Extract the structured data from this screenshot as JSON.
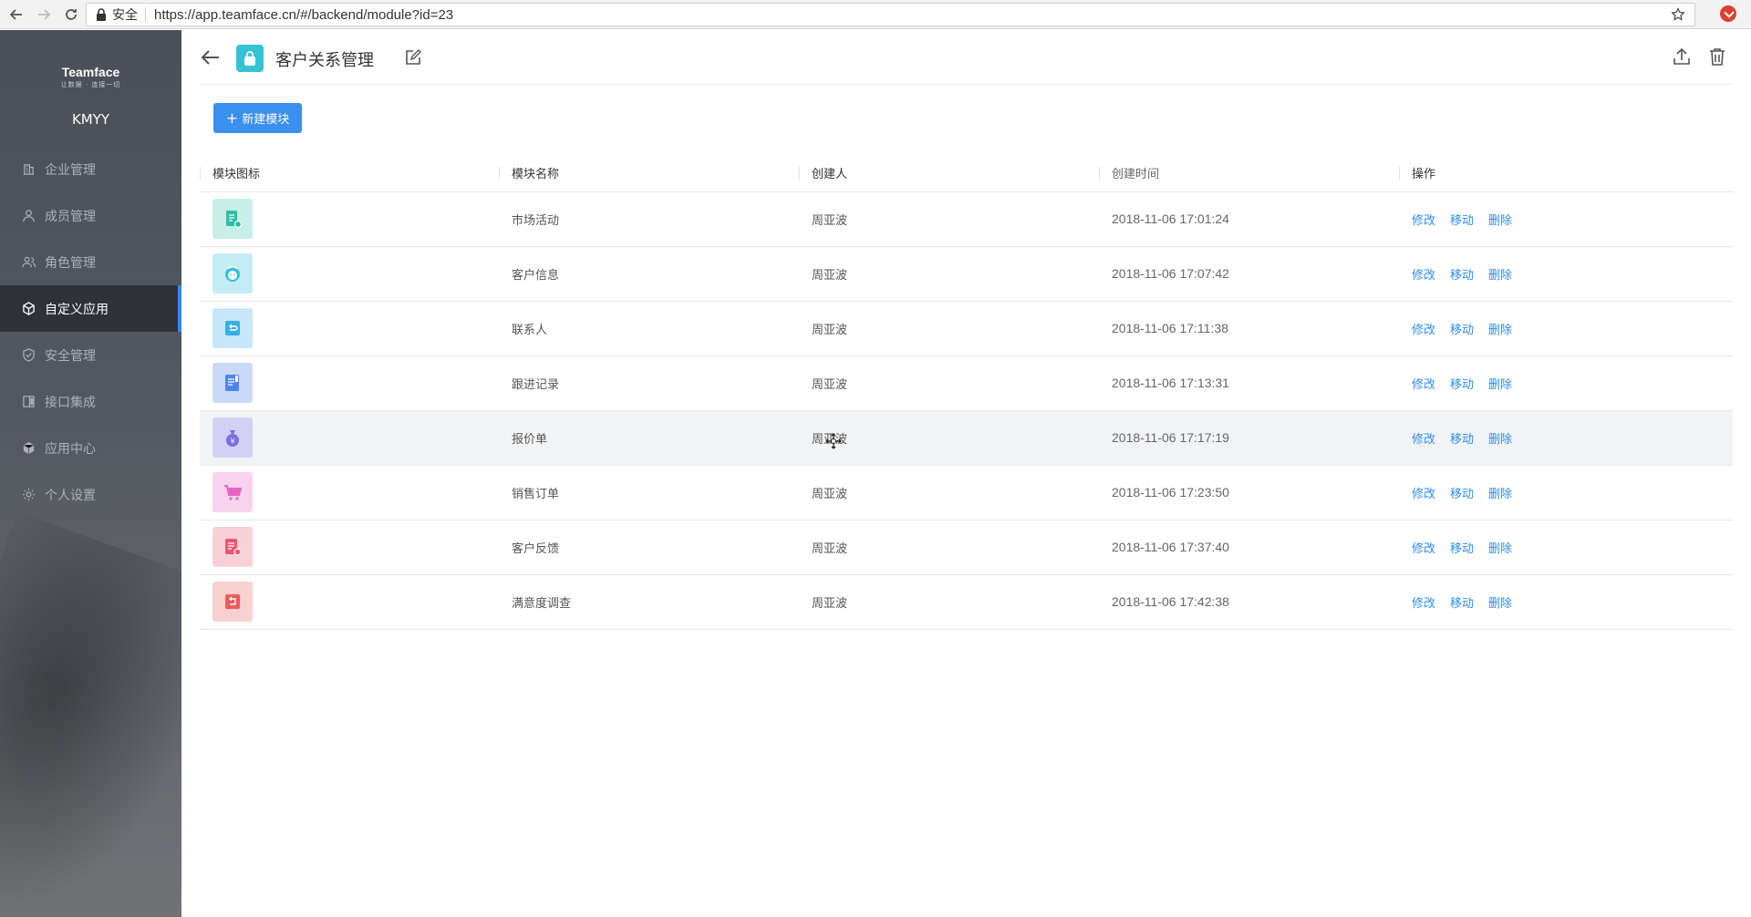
{
  "browser": {
    "secure_label": "安全",
    "url": "https://app.teamface.cn/#/backend/module?id=23"
  },
  "sidebar": {
    "brand_name": "Teamface",
    "brand_slogan": "让数据 · 连接一切",
    "company": "KMYY",
    "items": [
      {
        "label": "企业管理",
        "icon": "building-icon"
      },
      {
        "label": "成员管理",
        "icon": "user-icon"
      },
      {
        "label": "角色管理",
        "icon": "role-icon"
      },
      {
        "label": "自定义应用",
        "icon": "cube-icon",
        "active": true
      },
      {
        "label": "安全管理",
        "icon": "shield-icon"
      },
      {
        "label": "接口集成",
        "icon": "interface-icon"
      },
      {
        "label": "应用中心",
        "icon": "box-icon"
      },
      {
        "label": "个人设置",
        "icon": "gear-icon"
      }
    ]
  },
  "header": {
    "app_title": "客户关系管理",
    "app_icon": "lock-bag-icon",
    "app_color": "#33c3d3"
  },
  "toolbar": {
    "new_module_label": "新建模块"
  },
  "table": {
    "columns": [
      "模块图标",
      "模块名称",
      "创建人",
      "创建时间",
      "操作"
    ],
    "actions": [
      "修改",
      "移动",
      "删除"
    ],
    "rows": [
      {
        "name": "市场活动",
        "creator": "周亚波",
        "time": "2018-11-06 17:01:24",
        "icon": "document-icon",
        "bg": "#c7eee9",
        "fg": "#2bbfa6"
      },
      {
        "name": "客户信息",
        "creator": "周亚波",
        "time": "2018-11-06 17:07:42",
        "icon": "face-icon",
        "bg": "#c4ecf3",
        "fg": "#33c0d8"
      },
      {
        "name": "联系人",
        "creator": "周亚波",
        "time": "2018-11-06 17:11:38",
        "icon": "contact-icon",
        "bg": "#c6e7f7",
        "fg": "#37aee8"
      },
      {
        "name": "跟进记录",
        "creator": "周亚波",
        "time": "2018-11-06 17:13:31",
        "icon": "record-icon",
        "bg": "#cad9f6",
        "fg": "#4f86ee"
      },
      {
        "name": "报价单",
        "creator": "周亚波",
        "time": "2018-11-06 17:17:19",
        "icon": "money-bag-icon",
        "bg": "#d4d0f3",
        "fg": "#7b6fe0"
      },
      {
        "name": "销售订单",
        "creator": "周亚波",
        "time": "2018-11-06 17:23:50",
        "icon": "cart-icon",
        "bg": "#f7d3ee",
        "fg": "#e565c6"
      },
      {
        "name": "客户反馈",
        "creator": "周亚波",
        "time": "2018-11-06 17:37:40",
        "icon": "feedback-icon",
        "bg": "#f8d0d6",
        "fg": "#ee5670"
      },
      {
        "name": "满意度调查",
        "creator": "周亚波",
        "time": "2018-11-06 17:42:38",
        "icon": "survey-icon",
        "bg": "#f8d0d0",
        "fg": "#ef5a5a"
      }
    ]
  }
}
